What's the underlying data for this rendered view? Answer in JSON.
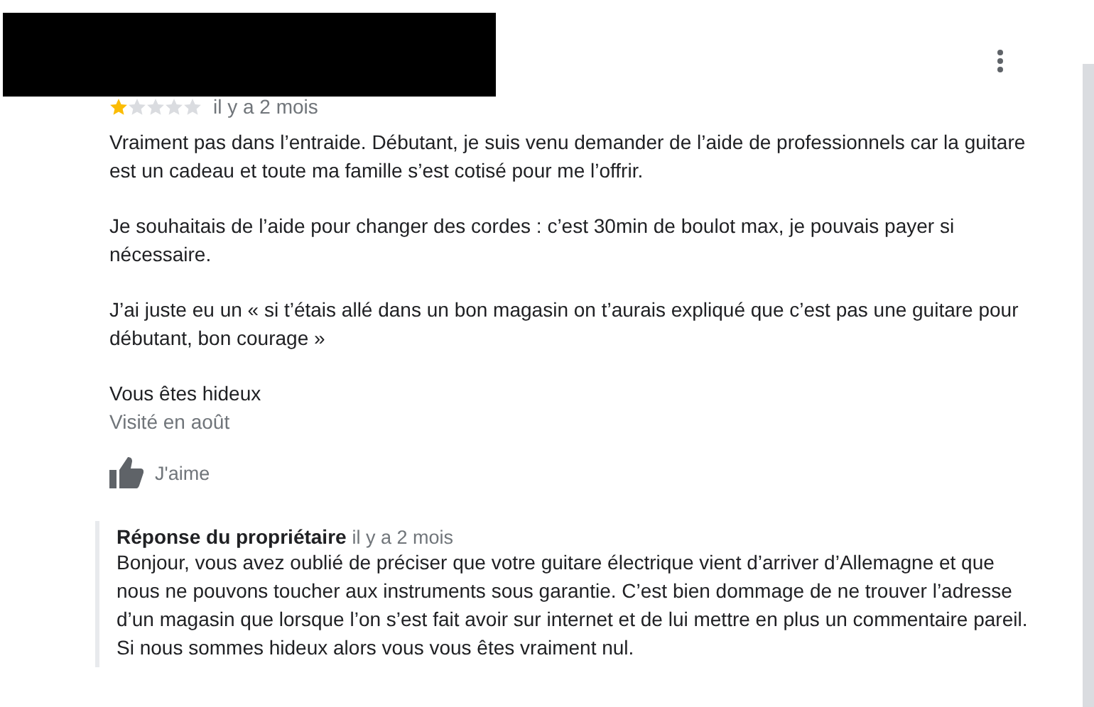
{
  "review": {
    "stars": 1,
    "time": "il y a 2 mois",
    "paragraphs": [
      "Vraiment pas dans l’entraide. Débutant, je suis venu demander de l’aide de professionnels car la guitare\nest un cadeau et toute ma famille s’est cotisé pour me l’offrir.",
      "Je souhaitais de l’aide pour changer des cordes : c’est 30min de boulot max, je pouvais payer si\nnécessaire.",
      "J’ai juste eu un « si t’étais allé dans un bon magasin on t’aurais expliqué que c’est pas une guitare pour\ndébutant, bon courage »",
      "Vous êtes hideux"
    ],
    "visited": "Visité en août",
    "like_label": "J'aime"
  },
  "owner_reply": {
    "title": "Réponse du propriétaire",
    "time": "il y a 2 mois",
    "text": "Bonjour, vous avez oublié de préciser que votre guitare électrique vient d’arriver d’Allemagne et que\nnous ne pouvons toucher aux instruments sous garantie. C’est bien dommage de ne trouver l’adresse\nd’un magasin que lorsque l’on s’est fait avoir sur internet et de lui mettre en plus un commentaire pareil.\nSi nous sommes hideux alors vous vous êtes vraiment nul."
  }
}
